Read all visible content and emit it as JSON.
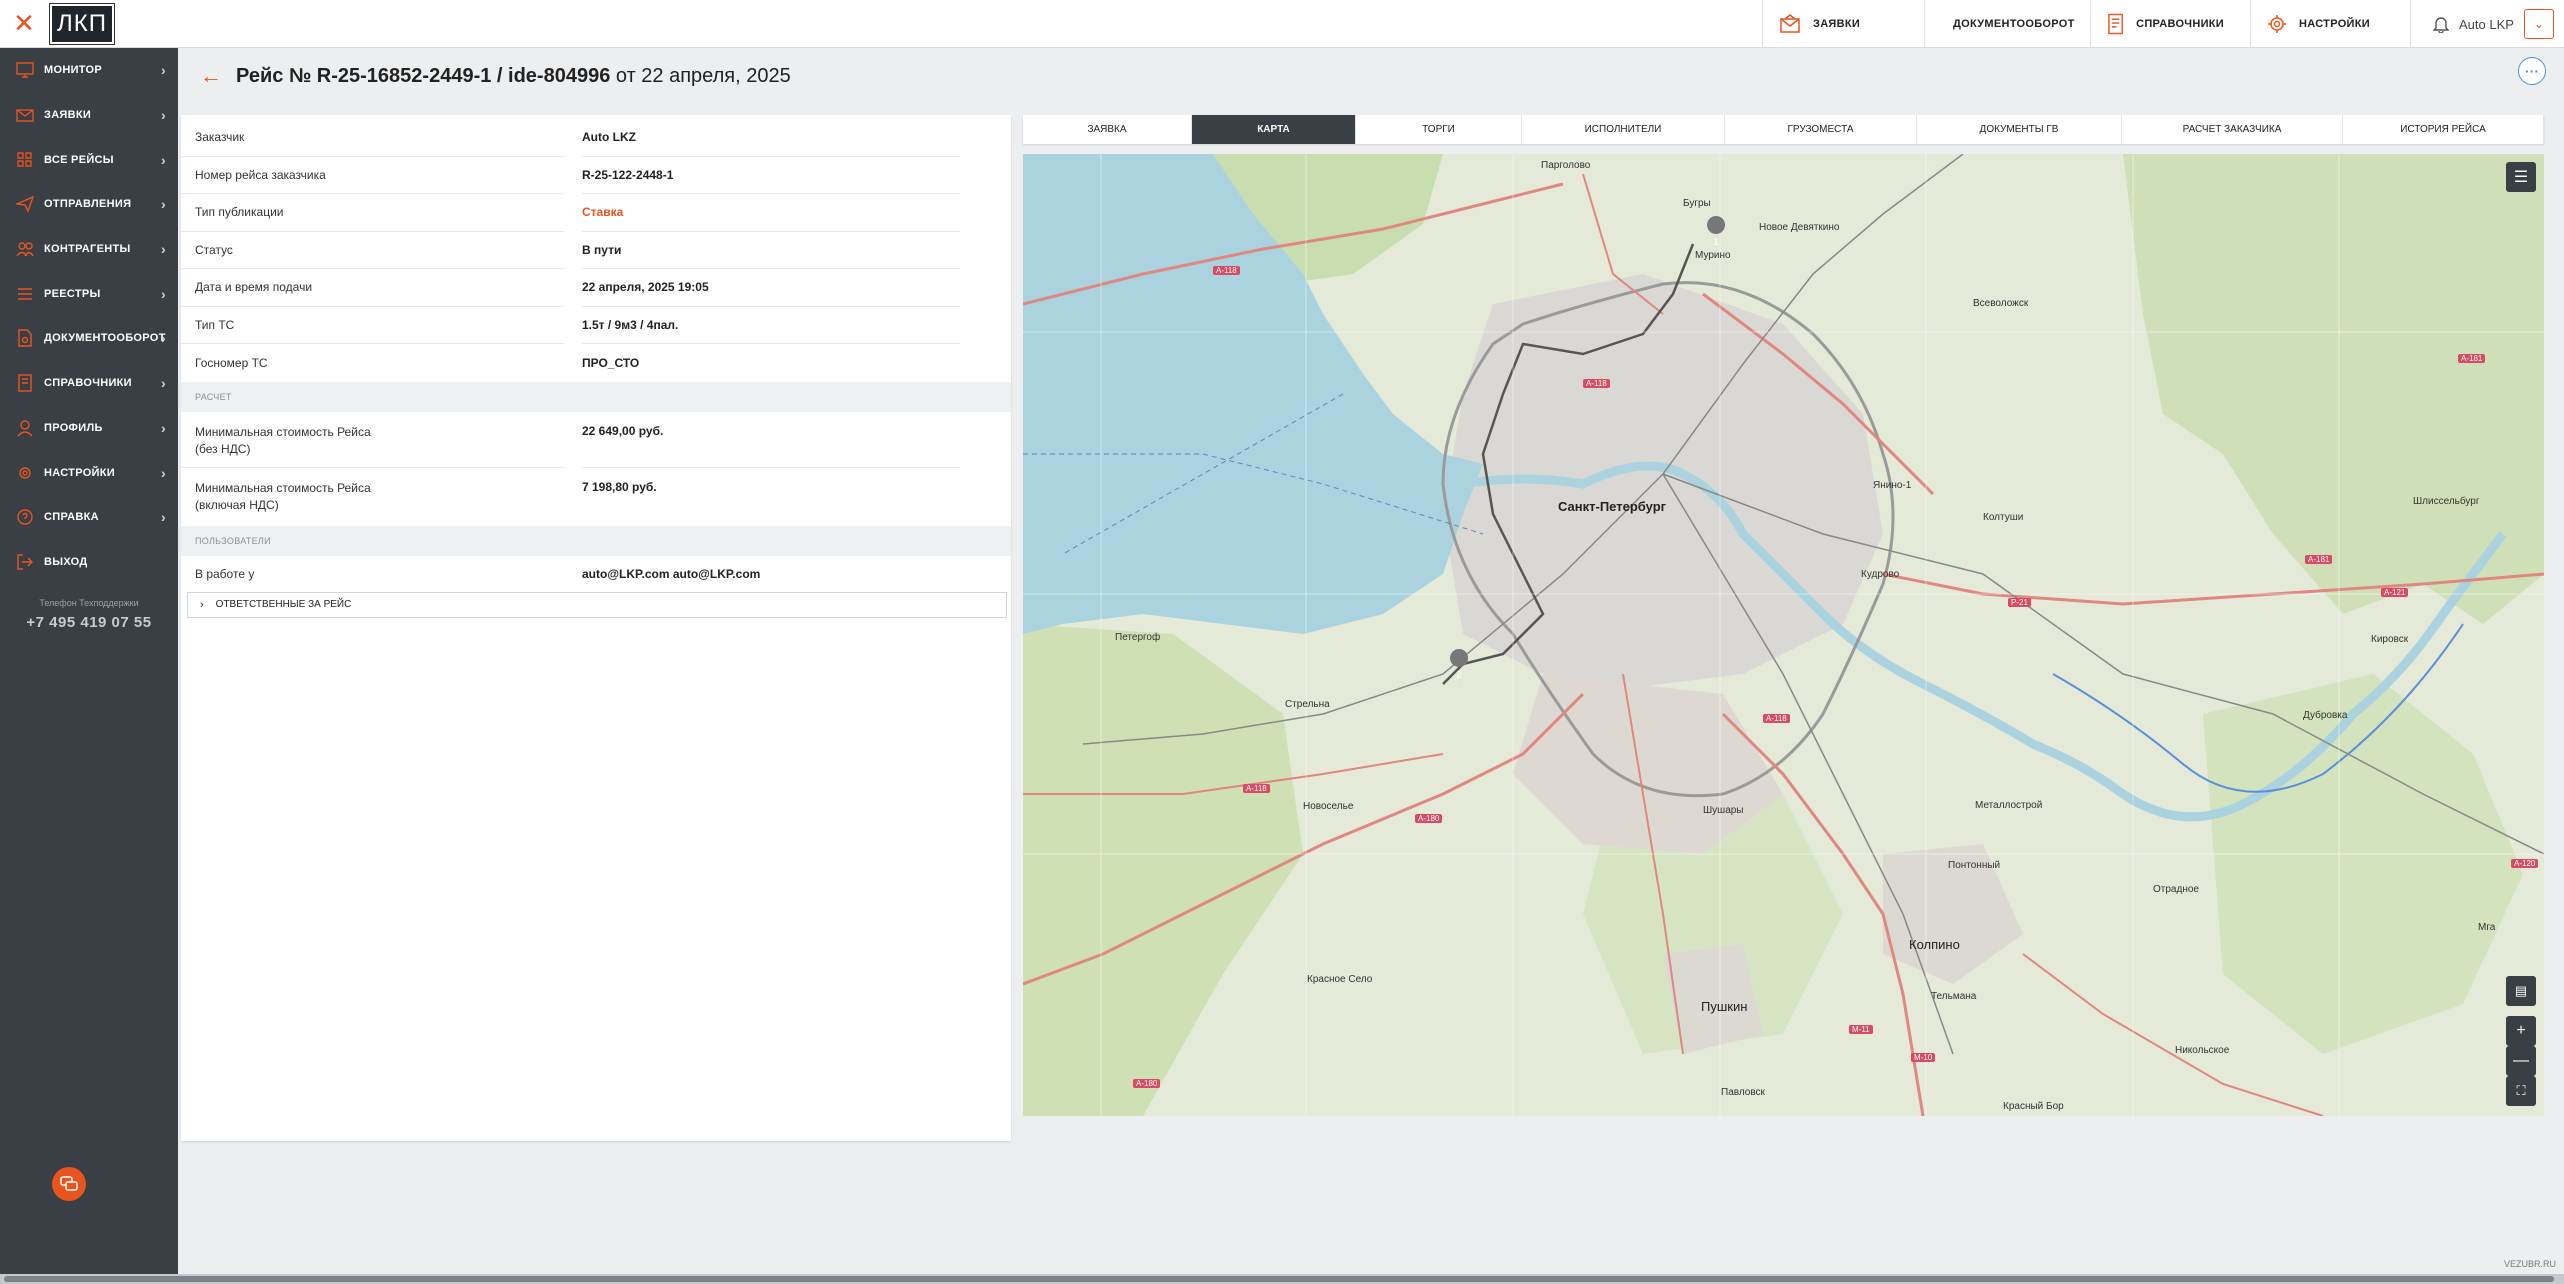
{
  "app": {
    "logo": "ЛКП"
  },
  "topnav": [
    {
      "label": "ЗАЯВКИ",
      "icon": "envelope-icon"
    },
    {
      "label": "ДОКУМЕНТООБОРОТ",
      "icon": "document-icon"
    },
    {
      "label": "СПРАВОЧНИКИ",
      "icon": "book-icon"
    },
    {
      "label": "НАСТРОЙКИ",
      "icon": "gear-icon"
    }
  ],
  "user": {
    "name": "Auto LKP"
  },
  "sidebar": {
    "items": [
      {
        "label": "МОНИТОР",
        "icon": "monitor-icon"
      },
      {
        "label": "ЗАЯВКИ",
        "icon": "envelope-icon"
      },
      {
        "label": "ВСЕ РЕЙСЫ",
        "icon": "grid-icon"
      },
      {
        "label": "ОТПРАВЛЕНИЯ",
        "icon": "send-icon"
      },
      {
        "label": "КОНТРАГЕНТЫ",
        "icon": "users-icon"
      },
      {
        "label": "РЕЕСТРЫ",
        "icon": "list-icon"
      },
      {
        "label": "ДОКУМЕНТООБОРОТ",
        "icon": "document-icon"
      },
      {
        "label": "СПРАВОЧНИКИ",
        "icon": "book-icon"
      },
      {
        "label": "ПРОФИЛЬ",
        "icon": "profile-icon"
      },
      {
        "label": "НАСТРОЙКИ",
        "icon": "gear-icon"
      },
      {
        "label": "СПРАВКА",
        "icon": "help-icon"
      },
      {
        "label": "ВЫХОД",
        "icon": "logout-icon"
      }
    ],
    "support_label": "Телефон Техподдержки",
    "support_phone": "+7 495 419 07 55"
  },
  "header": {
    "title_bold": "Рейс № R-25-16852-2449-1 / ide-804996",
    "title_rest": " от 22 апреля, 2025"
  },
  "details": {
    "rows": [
      {
        "key": "Заказчик",
        "value": "Auto LKZ"
      },
      {
        "key": "Номер рейса заказчика",
        "value": "R-25-122-2448-1"
      },
      {
        "key": "Тип публикации",
        "value": "Ставка"
      },
      {
        "key": "Статус",
        "value": "В пути"
      },
      {
        "key": "Дата и время подачи",
        "value": "22 апреля, 2025 19:05"
      },
      {
        "key": "Тип ТС",
        "value": "1.5т / 9м3 / 4пал."
      },
      {
        "key": "Госномер ТС",
        "value": "ПРО_СТО"
      }
    ],
    "calc_section": "РАСЧЕТ",
    "calc_rows": [
      {
        "key_line1": "Минимальная стоимость Рейса",
        "key_line2": "(без НДС)",
        "value": "22 649,00 руб."
      },
      {
        "key_line1": "Минимальная стоимость Рейса",
        "key_line2": "(включая НДС)",
        "value": "7 198,80 руб."
      }
    ],
    "users_section": "ПОЛЬЗОВАТЕЛИ",
    "users_rows": [
      {
        "key": "В работе у",
        "value": "auto@LKP.com auto@LKP.com"
      }
    ],
    "responsible_label": "ОТВЕТСТВЕННЫЕ ЗА РЕЙС"
  },
  "tabs": [
    {
      "label": "ЗАЯВКА",
      "active": false
    },
    {
      "label": "КАРТА",
      "active": true
    },
    {
      "label": "ТОРГИ",
      "active": false
    },
    {
      "label": "ИСПОЛНИТЕЛИ",
      "active": false
    },
    {
      "label": "ГРУЗОМЕСТА",
      "active": false
    },
    {
      "label": "ДОКУМЕНТЫ ГВ",
      "active": false
    },
    {
      "label": "РАСЧЕТ ЗАКАЗЧИКА",
      "active": false
    },
    {
      "label": "ИСТОРИЯ РЕЙСА",
      "active": false
    }
  ],
  "map": {
    "city": "Санкт-Петербург",
    "labels": [
      {
        "text": "Парголово",
        "kind": "normal"
      },
      {
        "text": "Всеволожск",
        "kind": "normal"
      },
      {
        "text": "Кудрово",
        "kind": "normal"
      },
      {
        "text": "Колтуши",
        "kind": "normal"
      },
      {
        "text": "Петергоф",
        "kind": "normal"
      },
      {
        "text": "Стрельна",
        "kind": "normal"
      },
      {
        "text": "Новосельe",
        "kind": "normal"
      },
      {
        "text": "Шушары",
        "kind": "normal"
      },
      {
        "text": "Колпино",
        "kind": "big"
      },
      {
        "text": "Пушкин",
        "kind": "big"
      },
      {
        "text": "Павловск",
        "kind": "normal"
      },
      {
        "text": "Красное Село",
        "kind": "normal"
      },
      {
        "text": "Металлострой",
        "kind": "normal"
      },
      {
        "text": "Понтонный",
        "kind": "normal"
      },
      {
        "text": "Тельмана",
        "kind": "normal"
      },
      {
        "text": "Отрадное",
        "kind": "normal"
      },
      {
        "text": "Кировск",
        "kind": "normal"
      },
      {
        "text": "Дубровка",
        "kind": "normal"
      },
      {
        "text": "Шлиссельбург",
        "kind": "normal"
      },
      {
        "text": "Никольское",
        "kind": "normal"
      },
      {
        "text": "Красный Бор",
        "kind": "normal"
      },
      {
        "text": "Мурино",
        "kind": "normal"
      },
      {
        "text": "Бугры",
        "kind": "normal"
      },
      {
        "text": "Янино-1",
        "kind": "normal"
      },
      {
        "text": "Мга",
        "kind": "normal"
      },
      {
        "text": "Новое Девяткино",
        "kind": "normal"
      }
    ],
    "roads": [
      "A-118",
      "A-118",
      "A-118",
      "A-118",
      "A-180",
      "A-180",
      "P-21",
      "A-181",
      "A-181",
      "A-121",
      "A-120",
      "M-11",
      "M-10"
    ],
    "markers": [
      "1",
      "2"
    ],
    "attribution": "VEZUBR.RU"
  },
  "colors": {
    "accent": "#e8541e",
    "sidebar": "#3a3f45",
    "water": "#aad3df",
    "park": "#c8deb0"
  }
}
